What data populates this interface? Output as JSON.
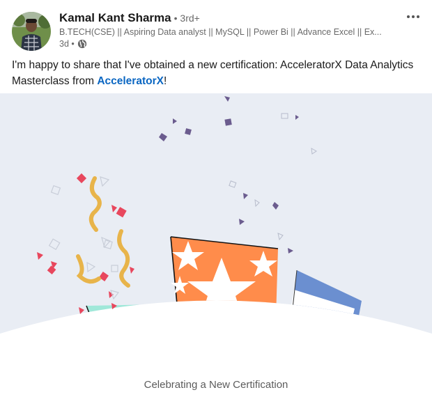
{
  "post": {
    "actor_name": "Kamal Kant Sharma",
    "degree": "• 3rd+",
    "headline": "B.TECH(CSE) || Aspiring Data analyst || MySQL || Power Bi || Advance Excel || Ex...",
    "time": "3d •",
    "text_before": "I'm happy to share that I've obtained a new certification: AcceleratorX Data Analytics Masterclass from ",
    "mention": "AcceleratorX",
    "text_after": "!",
    "caption": "Celebrating a New Certification"
  },
  "icons": {
    "more": "more-options-icon",
    "visibility": "globe-icon"
  },
  "colors": {
    "link": "#0a66c2",
    "banner_bg": "#e9edf4",
    "orange_gift": "#ff8c4b",
    "teal_gift": "#a0e8d9",
    "blue_gift": "#6b8fd0",
    "confetti_red": "#e8475d",
    "ribbon_yellow": "#e8b44a",
    "confetti_purple": "#6b5c8e"
  }
}
